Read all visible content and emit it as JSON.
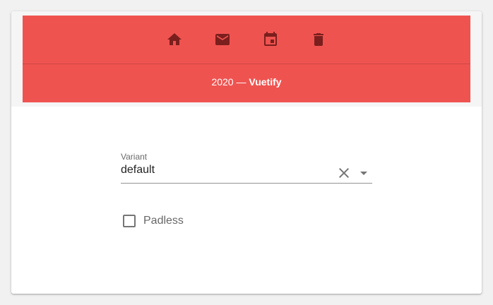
{
  "footer": {
    "icons": [
      "home-icon",
      "email-icon",
      "calendar-icon",
      "delete-icon"
    ],
    "year": "2020",
    "separator": " — ",
    "brand": "Vuetify",
    "background_color": "#ef5350",
    "icon_color": "#7a1f1d"
  },
  "controls": {
    "variant": {
      "label": "Variant",
      "value": "default"
    },
    "padless": {
      "label": "Padless",
      "checked": false
    }
  }
}
